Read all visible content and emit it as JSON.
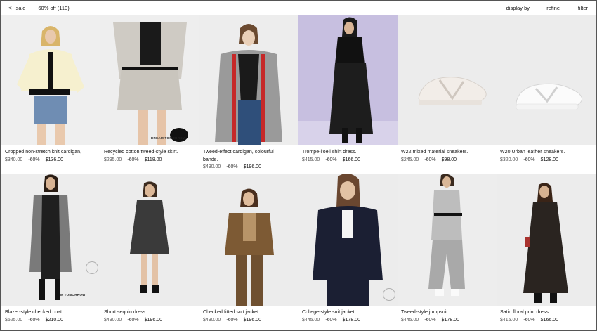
{
  "breadcrumb": {
    "back_icon": "<",
    "section": "sale",
    "separator": "|",
    "filter_label": "60% off (110)"
  },
  "controls": {
    "display": "display by",
    "refine": "refine",
    "filter": "filter"
  },
  "products": [
    {
      "name": "Cropped non-stretch knit cardigan,",
      "name2": "",
      "old_price": "$340.00",
      "discount": "-60%",
      "price": "$136.00"
    },
    {
      "name": "Recycled cotton tweed-style skirt.",
      "name2": "",
      "old_price": "$295.00",
      "discount": "-60%",
      "price": "$118.00",
      "watermark": "DREAM TOMORROW"
    },
    {
      "name": "Tweed-effect cardigan, colourful",
      "name2": "bands.",
      "old_price": "$490.00",
      "discount": "-60%",
      "price": "$196.00"
    },
    {
      "name": "Trompe-l’oeil shirt dress.",
      "name2": "",
      "old_price": "$415.00",
      "discount": "-60%",
      "price": "$166.00"
    },
    {
      "name": "W22 mixed material sneakers.",
      "name2": "",
      "old_price": "$245.00",
      "discount": "-60%",
      "price": "$98.00"
    },
    {
      "name": "W20 Urban leather sneakers.",
      "name2": "",
      "old_price": "$320.00",
      "discount": "-60%",
      "price": "$128.00"
    },
    {
      "name": "Blazer-style checked coat.",
      "name2": "",
      "old_price": "$525.00",
      "discount": "-60%",
      "price": "$210.00",
      "watermark": "M TOMORROW"
    },
    {
      "name": "Short sequin dress.",
      "name2": "",
      "old_price": "$490.00",
      "discount": "-60%",
      "price": "$196.00"
    },
    {
      "name": "Checked fitted suit jacket.",
      "name2": "",
      "old_price": "$490.00",
      "discount": "-60%",
      "price": "$196.00"
    },
    {
      "name": "College-style suit jacket.",
      "name2": "",
      "old_price": "$445.00",
      "discount": "-60%",
      "price": "$178.00"
    },
    {
      "name": "Tweed-style jumpsuit.",
      "name2": "",
      "old_price": "$445.00",
      "discount": "-60%",
      "price": "$178.00"
    },
    {
      "name": "Satin floral print dress.",
      "name2": "",
      "old_price": "$415.00",
      "discount": "-60%",
      "price": "$166.00"
    }
  ],
  "colors": {
    "background": "#ffffff",
    "text": "#111111",
    "backdrop_grey": "#ededed",
    "backdrop_lavender": "#c7bfe0"
  }
}
